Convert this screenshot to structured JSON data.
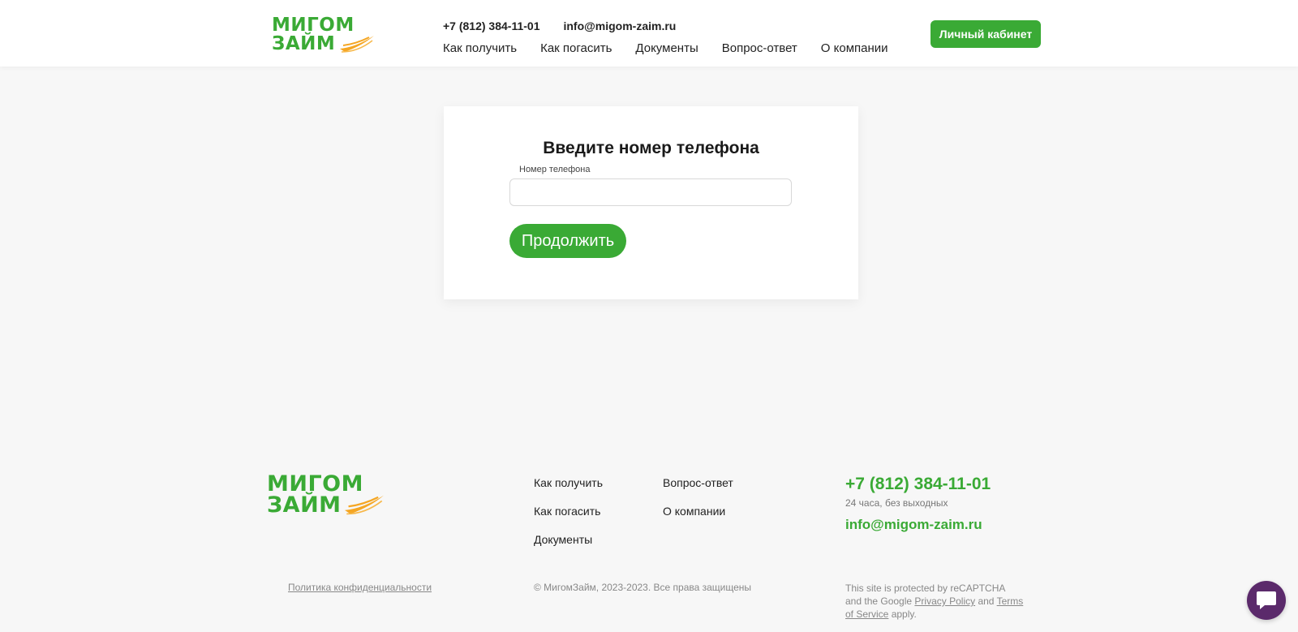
{
  "header": {
    "logo_line1": "МИГОМ",
    "logo_line2": "ЗАЙМ",
    "phone": "+7 (812) 384-11-01",
    "email": "info@migom-zaim.ru",
    "nav": [
      {
        "label": "Как получить"
      },
      {
        "label": "Как погасить"
      },
      {
        "label": "Документы"
      },
      {
        "label": "Вопрос-ответ"
      },
      {
        "label": "О компании"
      }
    ],
    "cabinet_label": "Личный кабинет"
  },
  "form": {
    "title": "Введите номер телефона",
    "phone_label": "Номер телефона",
    "phone_value": "",
    "continue_label": "Продолжить"
  },
  "footer": {
    "logo_line1": "МИГОМ",
    "logo_line2": "ЗАЙМ",
    "links": [
      {
        "label": "Как получить"
      },
      {
        "label": "Как погасить"
      },
      {
        "label": "Документы"
      },
      {
        "label": "Вопрос-ответ"
      },
      {
        "label": "О компании"
      }
    ],
    "phone": "+7 (812) 384-11-01",
    "hours": "24 часа, без выходных",
    "email": "info@migom-zaim.ru",
    "privacy": "Политика конфиденциальности",
    "copyright": "© МигомЗайм, 2023-2023. Все права защищены",
    "recaptcha_pre": "This site is protected by reCAPTCHA and the Google",
    "privacy_policy": "Privacy Policy",
    "and": "and",
    "terms": "Terms of Service",
    "apply": "apply."
  },
  "colors": {
    "brand_green": "#3aaa35",
    "swoosh_orange": "#f5a623",
    "chat_purple": "#5b2a6b"
  },
  "icons": {
    "logo_swoosh": "swoosh-icon",
    "chat": "chat-bubble-icon"
  }
}
